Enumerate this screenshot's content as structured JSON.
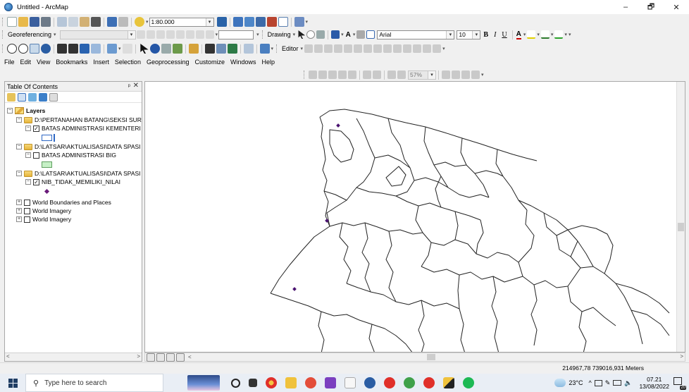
{
  "window": {
    "title": "Untitled - ArcMap",
    "controls": [
      "–",
      "🗗",
      "✕"
    ]
  },
  "toolbar1": {
    "scale_value": "1:80.000"
  },
  "toolbar2": {
    "georeferencing_label": "Georeferencing",
    "drawing_label": "Drawing",
    "font_name": "Arial",
    "font_size": "10",
    "bold": "B",
    "italic": "I",
    "underline": "U",
    "text_color_letter": "A"
  },
  "toolbar3": {
    "editor_label": "Editor"
  },
  "menu": {
    "items": [
      "File",
      "Edit",
      "View",
      "Bookmarks",
      "Insert",
      "Selection",
      "Geoprocessing",
      "Customize",
      "Windows",
      "Help"
    ]
  },
  "layout_toolbar": {
    "zoom_percent": "57%"
  },
  "toc": {
    "title": "Table Of Contents",
    "pin": "ᵖ",
    "close": "✕",
    "root": "Layers",
    "rows": [
      {
        "kind": "group",
        "label": "D:\\PERTANAHAN BATANG\\SEKSI SUR"
      },
      {
        "kind": "layer",
        "checked": true,
        "label": "BATAS ADMINISTRASI KEMENTERI"
      },
      {
        "kind": "group",
        "label": "D:\\LATSAR\\AKTUALISASI\\DATA SPASI"
      },
      {
        "kind": "layer",
        "checked": false,
        "label": "BATAS ADMINISTRASI BIG"
      },
      {
        "kind": "group",
        "label": "D:\\LATSAR\\AKTUALISASI\\DATA SPASI"
      },
      {
        "kind": "layer",
        "checked": true,
        "label": "NIB_TIDAK_MEMILIKI_NILAI"
      },
      {
        "kind": "basemap",
        "checked": false,
        "label": "World Boundaries and Places"
      },
      {
        "kind": "basemap",
        "checked": false,
        "label": "World Imagery"
      },
      {
        "kind": "basemap",
        "checked": false,
        "label": "World Imagery"
      }
    ],
    "symbol_colors": {
      "kementeri_fill": "#ffffff",
      "kementeri_outline": "#2d67c4",
      "big_fill": "#c6f0c6",
      "nib_point": "#6a1b7a"
    }
  },
  "status": {
    "coordinates": "214967,78  739016,931 Meters"
  },
  "taskbar": {
    "search_placeholder": "Type here to search",
    "temperature": "23°C",
    "time": "07.21",
    "date": "13/08/2022",
    "notification_count": "20"
  },
  "colors": {
    "map_line": "#222222",
    "point_marker": "#4a1270",
    "accent_blue": "#1d5fa8"
  }
}
